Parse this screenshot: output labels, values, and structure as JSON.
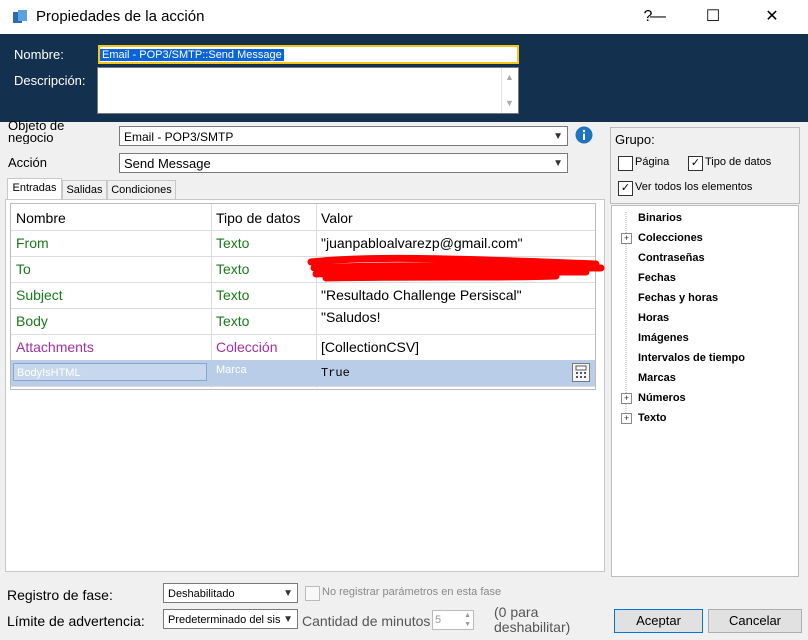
{
  "window": {
    "title": "Propiedades de la acción",
    "help_glyph": "?",
    "minimize_glyph": "—",
    "maximize_glyph": "☐",
    "close_glyph": "✕"
  },
  "header": {
    "name_label": "Nombre:",
    "name_value": "Email - POP3/SMTP::Send Message",
    "description_label": "Descripción:"
  },
  "form": {
    "business_object_label": "Objeto de negocio",
    "business_object_value": "Email - POP3/SMTP",
    "action_label": "Acción",
    "action_value": "Send Message"
  },
  "tabs": [
    "Entradas",
    "Salidas",
    "Condiciones"
  ],
  "grid": {
    "headers": [
      "Nombre",
      "Tipo de datos",
      "Valor"
    ],
    "rows": [
      {
        "name": "From",
        "type": "Texto",
        "value": "\"juanpabloalvarezp@gmail.com\""
      },
      {
        "name": "To",
        "type": "Texto",
        "value": ""
      },
      {
        "name": "Subject",
        "type": "Texto",
        "value": "\"Resultado Challenge Persiscal\""
      },
      {
        "name": "Body",
        "type": "Texto",
        "value": "\"Saludos!"
      },
      {
        "name": "Attachments",
        "type": "Colección",
        "value": "[CollectionCSV]"
      },
      {
        "name": "BodyIsHTML",
        "type": "Marca",
        "value": "True"
      }
    ]
  },
  "group": {
    "label": "Grupo:",
    "page_label": "Página",
    "page_checked": false,
    "datatype_label": "Tipo de datos",
    "datatype_checked": true,
    "viewall_label": "Ver todos los elementos",
    "viewall_checked": true
  },
  "tree": [
    {
      "label": "Binarios",
      "expandable": false
    },
    {
      "label": "Colecciones",
      "expandable": true
    },
    {
      "label": "Contraseñas",
      "expandable": false
    },
    {
      "label": "Fechas",
      "expandable": false
    },
    {
      "label": "Fechas y horas",
      "expandable": false
    },
    {
      "label": "Horas",
      "expandable": false
    },
    {
      "label": "Imágenes",
      "expandable": false
    },
    {
      "label": "Intervalos de tiempo",
      "expandable": false
    },
    {
      "label": "Marcas",
      "expandable": false
    },
    {
      "label": "Números",
      "expandable": true
    },
    {
      "label": "Texto",
      "expandable": true
    }
  ],
  "bottom": {
    "stage_log_label": "Registro de fase:",
    "stage_log_value": "Deshabilitado",
    "no_params_label": "No registrar parámetros en esta fase",
    "warning_label": "Límite de advertencia:",
    "warning_value": "Predeterminado del sis",
    "minutes_label": "Cantidad de minutos",
    "minutes_value": "5",
    "minutes_hint": "(0 para deshabilitar)",
    "ok_label": "Aceptar",
    "cancel_label": "Cancelar"
  },
  "colors": {
    "header_bg": "#14304f",
    "text_type": "#1a7a1a",
    "collection_type": "#a030a0",
    "selected_row": "#b9cde8",
    "redaction": "#ff0000"
  }
}
